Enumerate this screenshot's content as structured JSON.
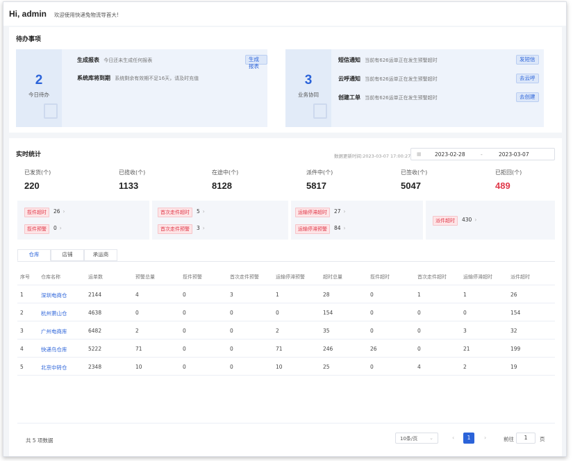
{
  "greeting": {
    "hi": "Hi, admin",
    "welcome": "欢迎使用快递兔物流导首大!"
  },
  "todo": {
    "title": "待办事项",
    "left": {
      "count": "2",
      "count_label": "今日待办",
      "items": [
        {
          "title": "生成报表",
          "desc": "今日还未生成任何报表",
          "action": "生成报表"
        },
        {
          "title": "系统库将到期",
          "desc": "系统剩余有效期不足16天，请及时充值",
          "action": ""
        }
      ]
    },
    "right": {
      "count": "3",
      "count_label": "业务协同",
      "items": [
        {
          "title": "短信通知",
          "desc": "当前有626运单正在发生预警超时",
          "action": "发短信"
        },
        {
          "title": "云呼通知",
          "desc": "当前有626运单正在发生预警超时",
          "action": "去云呼"
        },
        {
          "title": "创建工单",
          "desc": "当前有626运单正在发生预警超时",
          "action": "去创建"
        }
      ]
    }
  },
  "stats": {
    "title": "实时统计",
    "updated": "数据更新时间:2023-03-07 17:00:27",
    "date_from": "2023-02-28",
    "date_sep": "-",
    "date_to": "2023-03-07",
    "kpis": [
      {
        "label": "已发货(个)",
        "value": "220"
      },
      {
        "label": "已揽收(个)",
        "value": "1133"
      },
      {
        "label": "在途中(个)",
        "value": "8128"
      },
      {
        "label": "派件中(个)",
        "value": "5817"
      },
      {
        "label": "已签收(个)",
        "value": "5047"
      },
      {
        "label": "已拒回(个)",
        "value": "489"
      }
    ],
    "alerts": [
      {
        "tag": "揽件超时",
        "value": "26"
      },
      {
        "tag": "揽件预警",
        "value": "0"
      },
      {
        "tag": "首次走件超时",
        "value": "5"
      },
      {
        "tag": "首次走件预警",
        "value": "3"
      },
      {
        "tag": "运输停滞超时",
        "value": "27"
      },
      {
        "tag": "运输停滞预警",
        "value": "84"
      },
      {
        "tag": "派件超时",
        "value": "430"
      }
    ],
    "tabs": [
      "仓库",
      "店铺",
      "承运商"
    ]
  },
  "table": {
    "headers": [
      "序号",
      "仓库名称",
      "运单数",
      "预警总量",
      "揽件预警",
      "首次走件预警",
      "运输停滞预警",
      "超时总量",
      "揽件超时",
      "首次走件超时",
      "运输停滞超时",
      "派件超时"
    ],
    "rows": [
      [
        "1",
        "深圳电商仓",
        "2144",
        "4",
        "0",
        "3",
        "1",
        "28",
        "0",
        "1",
        "1",
        "26"
      ],
      [
        "2",
        "杭州萧山仓",
        "4638",
        "0",
        "0",
        "0",
        "0",
        "154",
        "0",
        "0",
        "0",
        "154"
      ],
      [
        "3",
        "广州电商库",
        "6482",
        "2",
        "0",
        "0",
        "2",
        "35",
        "0",
        "0",
        "3",
        "32"
      ],
      [
        "4",
        "快递鸟仓库",
        "5222",
        "71",
        "0",
        "0",
        "71",
        "246",
        "26",
        "0",
        "21",
        "199"
      ],
      [
        "5",
        "北京中转仓",
        "2348",
        "10",
        "0",
        "0",
        "10",
        "25",
        "0",
        "4",
        "2",
        "19"
      ]
    ]
  },
  "pagination": {
    "total": "共 5 项数据",
    "page_size": "10条/页",
    "current": "1",
    "goto_label": "前往",
    "goto_value": "1",
    "page_suffix": "页"
  }
}
